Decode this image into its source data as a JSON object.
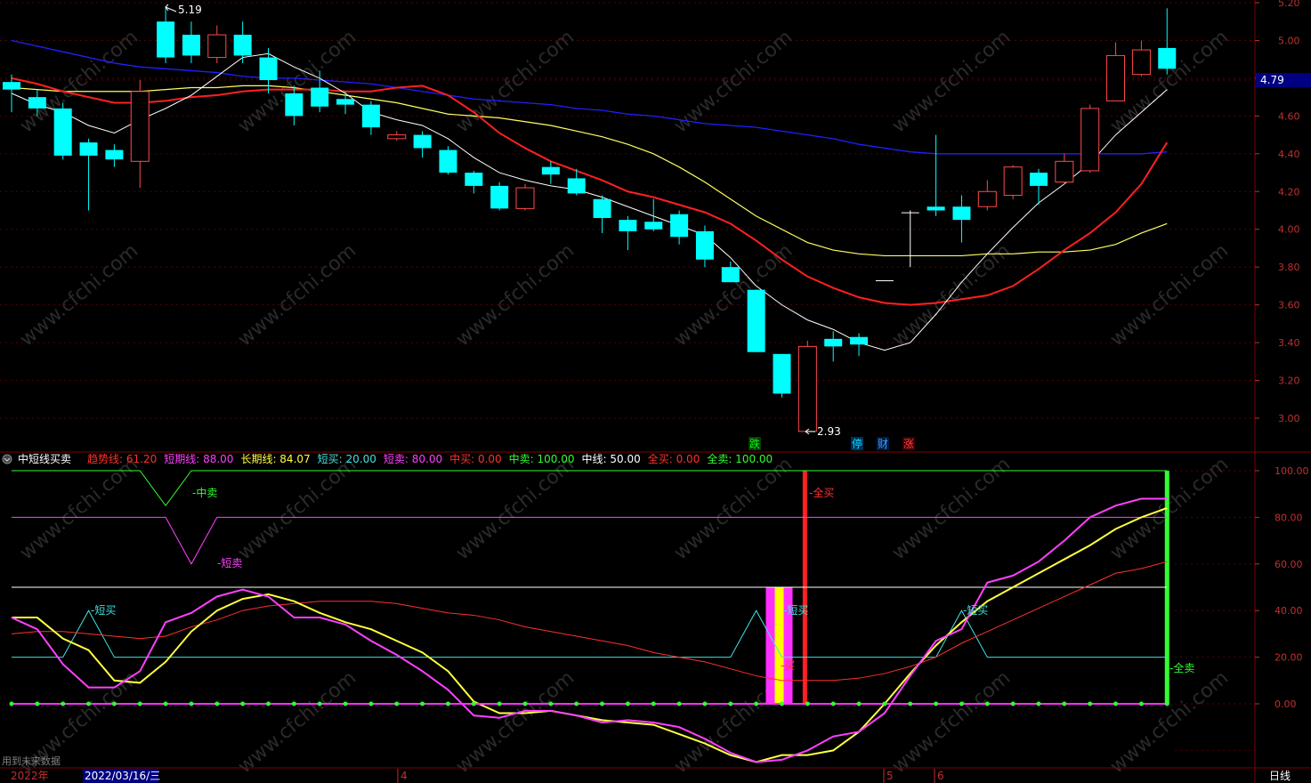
{
  "main": {
    "high_label": "5.19",
    "low_label": "2.93",
    "price_tag": "4.79",
    "y_ticks": [
      "5.20",
      "5.00",
      "4.80",
      "4.60",
      "4.40",
      "4.20",
      "4.00",
      "3.80",
      "3.60",
      "3.40",
      "3.20",
      "3.00"
    ],
    "markers": [
      {
        "text": "跌",
        "color": "#00ff00",
        "bg": "#0a3a0a"
      },
      {
        "text": "停",
        "color": "#00e0ff",
        "bg": "#00305a"
      },
      {
        "text": "财",
        "color": "#3aa0ff",
        "bg": "#001a40"
      },
      {
        "text": "涨",
        "color": "#ff4040",
        "bg": "#3a0000"
      }
    ],
    "colors": {
      "up": "#ff4a4a",
      "down": "#00ffff",
      "ma5": "#ffffff",
      "ma10": "#ff2020",
      "ma20": "#ffff60",
      "ma60": "#2020ff"
    }
  },
  "indicator": {
    "title": "中短线买卖",
    "values": [
      {
        "label": "趋势线:",
        "value": "61.20",
        "color": "#ff3030"
      },
      {
        "label": "短期线:",
        "value": "88.00",
        "color": "#ff40ff"
      },
      {
        "label": "长期线:",
        "value": "84.07",
        "color": "#ffff40"
      },
      {
        "label": "短买:",
        "value": "20.00",
        "color": "#40e0e0"
      },
      {
        "label": "短卖:",
        "value": "80.00",
        "color": "#ff40ff"
      },
      {
        "label": "中买:",
        "value": "0.00",
        "color": "#ff3030"
      },
      {
        "label": "中卖:",
        "value": "100.00",
        "color": "#30ff30"
      },
      {
        "label": "中线:",
        "value": "50.00",
        "color": "#ffffff"
      },
      {
        "label": "全买:",
        "value": "0.00",
        "color": "#ff3030"
      },
      {
        "label": "全卖:",
        "value": "100.00",
        "color": "#30ff30"
      }
    ],
    "y_ticks": [
      "100.00",
      "80.00",
      "60.00",
      "40.00",
      "20.00",
      "0.00"
    ],
    "annotations": {
      "zhongmai": "中卖",
      "duanmai_sell": "短卖",
      "duanmai_buy": "短买",
      "quanmai_buy": "全买",
      "quanmai_sell": "全卖",
      "mai_buy": "买"
    }
  },
  "footer": {
    "note": "用到未来数据",
    "year": "2022年",
    "date": "2022/03/16/三",
    "months": [
      "4",
      "5",
      "6"
    ],
    "period": "日线"
  },
  "watermark": "www.cfchi.com",
  "chart_data": [
    {
      "type": "candlestick",
      "title": "",
      "ylim": [
        2.9,
        5.22
      ],
      "candles": [
        {
          "o": 4.78,
          "c": 4.74,
          "h": 4.82,
          "l": 4.62
        },
        {
          "o": 4.7,
          "c": 4.64,
          "h": 4.74,
          "l": 4.6
        },
        {
          "o": 4.64,
          "c": 4.39,
          "h": 4.67,
          "l": 4.37
        },
        {
          "o": 4.46,
          "c": 4.39,
          "h": 4.48,
          "l": 4.1
        },
        {
          "o": 4.42,
          "c": 4.37,
          "h": 4.45,
          "l": 4.33
        },
        {
          "o": 4.36,
          "c": 4.73,
          "h": 4.79,
          "l": 4.22
        },
        {
          "o": 5.1,
          "c": 4.91,
          "h": 5.18,
          "l": 4.88
        },
        {
          "o": 5.03,
          "c": 4.92,
          "h": 5.1,
          "l": 4.88
        },
        {
          "o": 4.91,
          "c": 5.03,
          "h": 5.08,
          "l": 4.88
        },
        {
          "o": 5.03,
          "c": 4.92,
          "h": 5.1,
          "l": 4.88
        },
        {
          "o": 4.91,
          "c": 4.79,
          "h": 4.96,
          "l": 4.72
        },
        {
          "o": 4.72,
          "c": 4.6,
          "h": 4.76,
          "l": 4.55
        },
        {
          "o": 4.75,
          "c": 4.65,
          "h": 4.84,
          "l": 4.62
        },
        {
          "o": 4.69,
          "c": 4.66,
          "h": 4.73,
          "l": 4.61
        },
        {
          "o": 4.66,
          "c": 4.54,
          "h": 4.68,
          "l": 4.5
        },
        {
          "o": 4.48,
          "c": 4.5,
          "h": 4.52,
          "l": 4.47
        },
        {
          "o": 4.5,
          "c": 4.43,
          "h": 4.52,
          "l": 4.38
        },
        {
          "o": 4.42,
          "c": 4.3,
          "h": 4.44,
          "l": 4.29
        },
        {
          "o": 4.3,
          "c": 4.23,
          "h": 4.31,
          "l": 4.19
        },
        {
          "o": 4.23,
          "c": 4.11,
          "h": 4.25,
          "l": 4.1
        },
        {
          "o": 4.11,
          "c": 4.22,
          "h": 4.24,
          "l": 4.1
        },
        {
          "o": 4.33,
          "c": 4.29,
          "h": 4.36,
          "l": 4.24
        },
        {
          "o": 4.27,
          "c": 4.19,
          "h": 4.32,
          "l": 4.18
        },
        {
          "o": 4.16,
          "c": 4.06,
          "h": 4.18,
          "l": 3.98
        },
        {
          "o": 4.05,
          "c": 3.99,
          "h": 4.07,
          "l": 3.89
        },
        {
          "o": 4.04,
          "c": 4.0,
          "h": 4.16,
          "l": 3.99
        },
        {
          "o": 4.08,
          "c": 3.96,
          "h": 4.1,
          "l": 3.92
        },
        {
          "o": 3.99,
          "c": 3.84,
          "h": 4.02,
          "l": 3.8
        },
        {
          "o": 3.8,
          "c": 3.72,
          "h": 3.83,
          "l": 3.72
        },
        {
          "o": 3.68,
          "c": 3.35,
          "h": 3.68,
          "l": 3.35
        },
        {
          "o": 3.34,
          "c": 3.13,
          "h": 3.34,
          "l": 3.11
        },
        {
          "o": 2.93,
          "c": 3.38,
          "h": 3.41,
          "l": 2.93
        },
        {
          "o": 3.42,
          "c": 3.38,
          "h": 3.46,
          "l": 3.3
        },
        {
          "o": 3.43,
          "c": 3.39,
          "h": 3.45,
          "l": 3.33
        },
        {
          "o": 3.73,
          "c": 3.73,
          "h": 3.73,
          "l": 3.73
        },
        {
          "o": 4.09,
          "c": 4.09,
          "h": 4.1,
          "l": 3.8
        },
        {
          "o": 4.12,
          "c": 4.1,
          "h": 4.5,
          "l": 4.07
        },
        {
          "o": 4.12,
          "c": 4.05,
          "h": 4.18,
          "l": 3.93
        },
        {
          "o": 4.12,
          "c": 4.2,
          "h": 4.26,
          "l": 4.1
        },
        {
          "o": 4.18,
          "c": 4.33,
          "h": 4.34,
          "l": 4.16
        },
        {
          "o": 4.3,
          "c": 4.23,
          "h": 4.32,
          "l": 4.13
        },
        {
          "o": 4.25,
          "c": 4.36,
          "h": 4.4,
          "l": 4.24
        },
        {
          "o": 4.31,
          "c": 4.64,
          "h": 4.66,
          "l": 4.3
        },
        {
          "o": 4.68,
          "c": 4.92,
          "h": 4.99,
          "l": 4.68
        },
        {
          "o": 4.82,
          "c": 4.95,
          "h": 5.0,
          "l": 4.81
        },
        {
          "o": 4.96,
          "c": 4.85,
          "h": 5.17,
          "l": 4.82
        }
      ],
      "ma5": [
        4.72,
        4.66,
        4.62,
        4.55,
        4.51,
        4.58,
        4.64,
        4.71,
        4.81,
        4.91,
        4.93,
        4.86,
        4.8,
        4.72,
        4.62,
        4.58,
        4.55,
        4.48,
        4.38,
        4.3,
        4.26,
        4.23,
        4.21,
        4.17,
        4.12,
        4.07,
        4.02,
        3.97,
        3.85,
        3.7,
        3.6,
        3.52,
        3.47,
        3.4,
        3.36,
        3.4,
        3.55,
        3.72,
        3.87,
        4.01,
        4.14,
        4.24,
        4.35,
        4.5,
        4.62,
        4.74
      ],
      "ma10": [
        4.8,
        4.77,
        4.73,
        4.7,
        4.67,
        4.67,
        4.68,
        4.7,
        4.71,
        4.73,
        4.74,
        4.74,
        4.74,
        4.73,
        4.73,
        4.75,
        4.76,
        4.71,
        4.62,
        4.51,
        4.43,
        4.36,
        4.31,
        4.26,
        4.2,
        4.17,
        4.13,
        4.09,
        4.03,
        3.94,
        3.84,
        3.75,
        3.69,
        3.64,
        3.61,
        3.6,
        3.61,
        3.63,
        3.65,
        3.7,
        3.79,
        3.89,
        3.98,
        4.09,
        4.24,
        4.46
      ],
      "ma20": [
        4.75,
        4.74,
        4.73,
        4.73,
        4.73,
        4.73,
        4.74,
        4.75,
        4.75,
        4.76,
        4.76,
        4.75,
        4.73,
        4.71,
        4.69,
        4.67,
        4.64,
        4.61,
        4.6,
        4.59,
        4.57,
        4.55,
        4.52,
        4.49,
        4.45,
        4.4,
        4.33,
        4.25,
        4.16,
        4.07,
        4.0,
        3.93,
        3.89,
        3.87,
        3.86,
        3.86,
        3.86,
        3.86,
        3.87,
        3.87,
        3.88,
        3.88,
        3.89,
        3.92,
        3.98,
        4.03
      ],
      "ma60": [
        5.0,
        4.97,
        4.94,
        4.91,
        4.88,
        4.86,
        4.85,
        4.84,
        4.83,
        4.81,
        4.8,
        4.8,
        4.79,
        4.78,
        4.77,
        4.75,
        4.73,
        4.71,
        4.69,
        4.68,
        4.67,
        4.66,
        4.64,
        4.63,
        4.61,
        4.6,
        4.58,
        4.56,
        4.55,
        4.54,
        4.52,
        4.5,
        4.48,
        4.45,
        4.43,
        4.41,
        4.4,
        4.4,
        4.4,
        4.4,
        4.4,
        4.4,
        4.4,
        4.4,
        4.4,
        4.41
      ]
    },
    {
      "type": "line",
      "title": "中短线买卖",
      "ylim": [
        -28,
        105
      ],
      "series": [
        {
          "name": "趋势线",
          "color": "#ff3030",
          "values": [
            30,
            31,
            31,
            30,
            29,
            28,
            29,
            33,
            36,
            40,
            42,
            43,
            44,
            44,
            44,
            43,
            41,
            39,
            38,
            36,
            33,
            31,
            29,
            27,
            25,
            22,
            20,
            18,
            15,
            12,
            10,
            10,
            10,
            11,
            13,
            16,
            20,
            26,
            31,
            36,
            41,
            46,
            51,
            56,
            58,
            61
          ]
        },
        {
          "name": "短期线",
          "color": "#ff40ff",
          "values": [
            37,
            32,
            17,
            7,
            7,
            14,
            35,
            39,
            46,
            49,
            46,
            37,
            37,
            34,
            27,
            21,
            14,
            6,
            -5,
            -6,
            -3,
            -3,
            -5,
            -8,
            -7,
            -8,
            -10,
            -15,
            -21,
            -25,
            -24,
            -20,
            -14,
            -12,
            -4,
            12,
            27,
            32,
            52,
            55,
            61,
            70,
            80,
            85,
            88,
            88
          ]
        },
        {
          "name": "长期线",
          "color": "#ffff40",
          "values": [
            37,
            37,
            28,
            23,
            10,
            9,
            18,
            31,
            40,
            45,
            47,
            44,
            39,
            35,
            32,
            27,
            22,
            14,
            1,
            -4,
            -4,
            -3,
            -5,
            -7,
            -8,
            -9,
            -13,
            -17,
            -22,
            -25,
            -22,
            -22,
            -20,
            -12,
            0,
            13,
            25,
            35,
            44,
            50,
            56,
            62,
            68,
            75,
            80,
            84
          ]
        },
        {
          "name": "短买",
          "color": "#40e0e0",
          "values": [
            20,
            20,
            20,
            40,
            20,
            20,
            20,
            20,
            20,
            20,
            20,
            20,
            20,
            20,
            20,
            20,
            20,
            20,
            20,
            20,
            20,
            20,
            20,
            20,
            20,
            20,
            20,
            20,
            20,
            40,
            20,
            20,
            20,
            20,
            20,
            20,
            20,
            40,
            20,
            20,
            20,
            20,
            20,
            20,
            20,
            20
          ]
        },
        {
          "name": "短卖",
          "color": "#ff40ff",
          "values": [
            80,
            80,
            80,
            80,
            80,
            80,
            80,
            60,
            80,
            80,
            80,
            80,
            80,
            80,
            80,
            80,
            80,
            80,
            80,
            80,
            80,
            80,
            80,
            80,
            80,
            80,
            80,
            80,
            80,
            80,
            80,
            80,
            80,
            80,
            80,
            80,
            80,
            80,
            80,
            80,
            80,
            80,
            80,
            80,
            80,
            80
          ]
        },
        {
          "name": "中卖",
          "color": "#30ff30",
          "values": [
            100,
            100,
            100,
            100,
            100,
            100,
            85,
            100,
            100,
            100,
            100,
            100,
            100,
            100,
            100,
            100,
            100,
            100,
            100,
            100,
            100,
            100,
            100,
            100,
            100,
            100,
            100,
            100,
            100,
            100,
            100,
            100,
            100,
            100,
            100,
            100,
            100,
            100,
            100,
            100,
            100,
            100,
            100,
            100,
            100,
            100
          ]
        },
        {
          "name": "中线",
          "color": "#ffffff",
          "values": [
            50,
            50,
            50,
            50,
            50,
            50,
            50,
            50,
            50,
            50,
            50,
            50,
            50,
            50,
            50,
            50,
            50,
            50,
            50,
            50,
            50,
            50,
            50,
            50,
            50,
            50,
            50,
            50,
            50,
            50,
            50,
            50,
            50,
            50,
            50,
            50,
            50,
            50,
            50,
            50,
            50,
            50,
            50,
            50,
            50,
            50
          ]
        }
      ]
    }
  ]
}
